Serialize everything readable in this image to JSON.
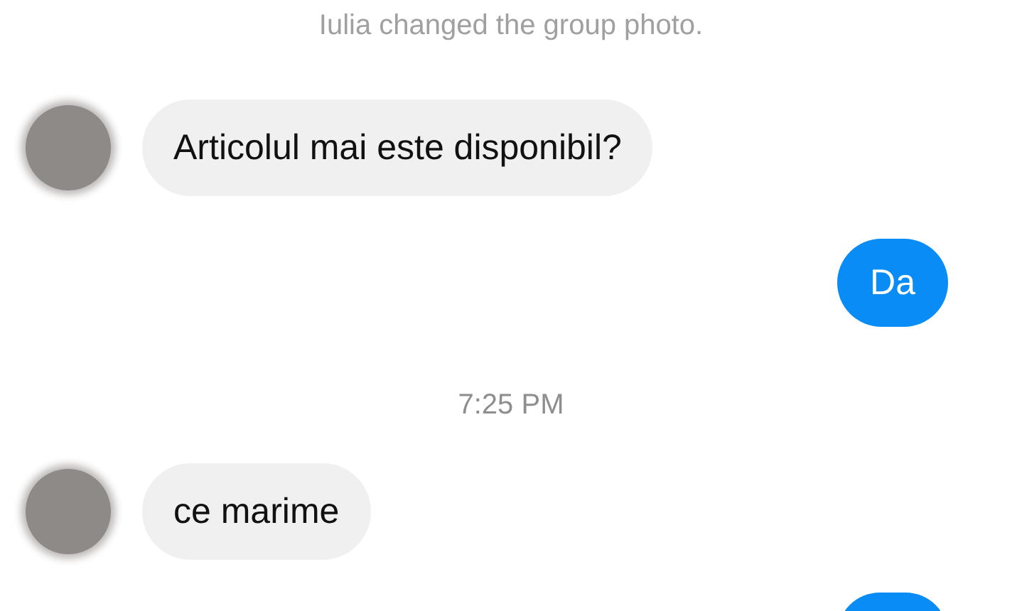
{
  "system_notice": "Iulia changed the group photo.",
  "messages": [
    {
      "kind": "incoming",
      "text": "Articolul mai este disponibil?"
    },
    {
      "kind": "outgoing",
      "text": "Da"
    },
    {
      "kind": "timestamp",
      "text": "7:25 PM"
    },
    {
      "kind": "incoming",
      "text": "ce marime"
    },
    {
      "kind": "outgoing"
    }
  ]
}
